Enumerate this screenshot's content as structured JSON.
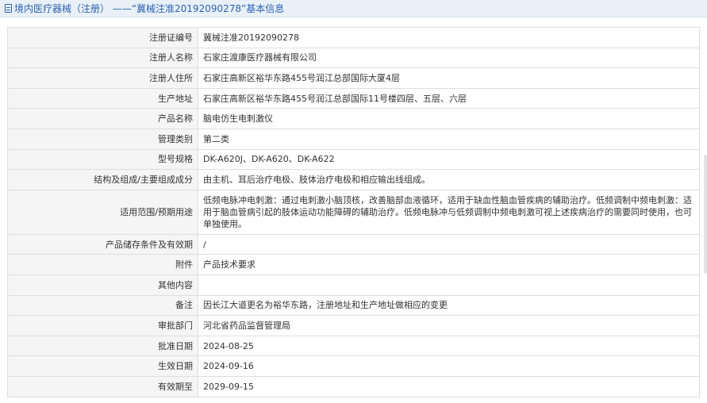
{
  "header": {
    "title": "境内医疗器械（注册） ——“冀械注准20192090278”基本信息"
  },
  "rows": [
    {
      "label": "注册证编号",
      "value": "冀械注准20192090278"
    },
    {
      "label": "注册人名称",
      "value": "石家庄渡康医疗器械有限公司"
    },
    {
      "label": "注册人住所",
      "value": "石家庄高新区裕华东路455号润江总部国际大厦4层"
    },
    {
      "label": "生产地址",
      "value": "石家庄高新区裕华东路455号润江总部国际11号楼四层、五层、六层"
    },
    {
      "label": "产品名称",
      "value": "脑电仿生电刺激仪"
    },
    {
      "label": "管理类别",
      "value": "第二类"
    },
    {
      "label": "型号规格",
      "value": "DK-A620J、DK-A620、DK-A622"
    },
    {
      "label": "结构及组成/主要组成成分",
      "value": "由主机、耳后治疗电极、肢体治疗电极和相应输出线组成。"
    },
    {
      "label": "适用范围/预期用途",
      "value": "低频电脉冲电刺激：通过电刺激小脑顶核，改善脑部血液循环，适用于缺血性脑血管疾病的辅助治疗。低频调制中频电刺激：适用于脑血管病引起的肢体运动功能障碍的辅助治疗。低频电脉冲与低频调制中频电刺激可视上述疾病治疗的需要同时使用，也可单独使用。"
    },
    {
      "label": "产品储存条件及有效期",
      "value": "/"
    },
    {
      "label": "附件",
      "value": "产品技术要求"
    },
    {
      "label": "其他内容",
      "value": ""
    },
    {
      "label": "备注",
      "value": "因长江大道更名为裕华东路，注册地址和生产地址做相应的变更"
    },
    {
      "label": "审批部门",
      "value": "河北省药品监督管理局"
    },
    {
      "label": "批准日期",
      "value": "2024-08-25"
    },
    {
      "label": "生效日期",
      "value": "2024-09-16"
    },
    {
      "label": "有效期至",
      "value": "2029-09-15"
    }
  ]
}
